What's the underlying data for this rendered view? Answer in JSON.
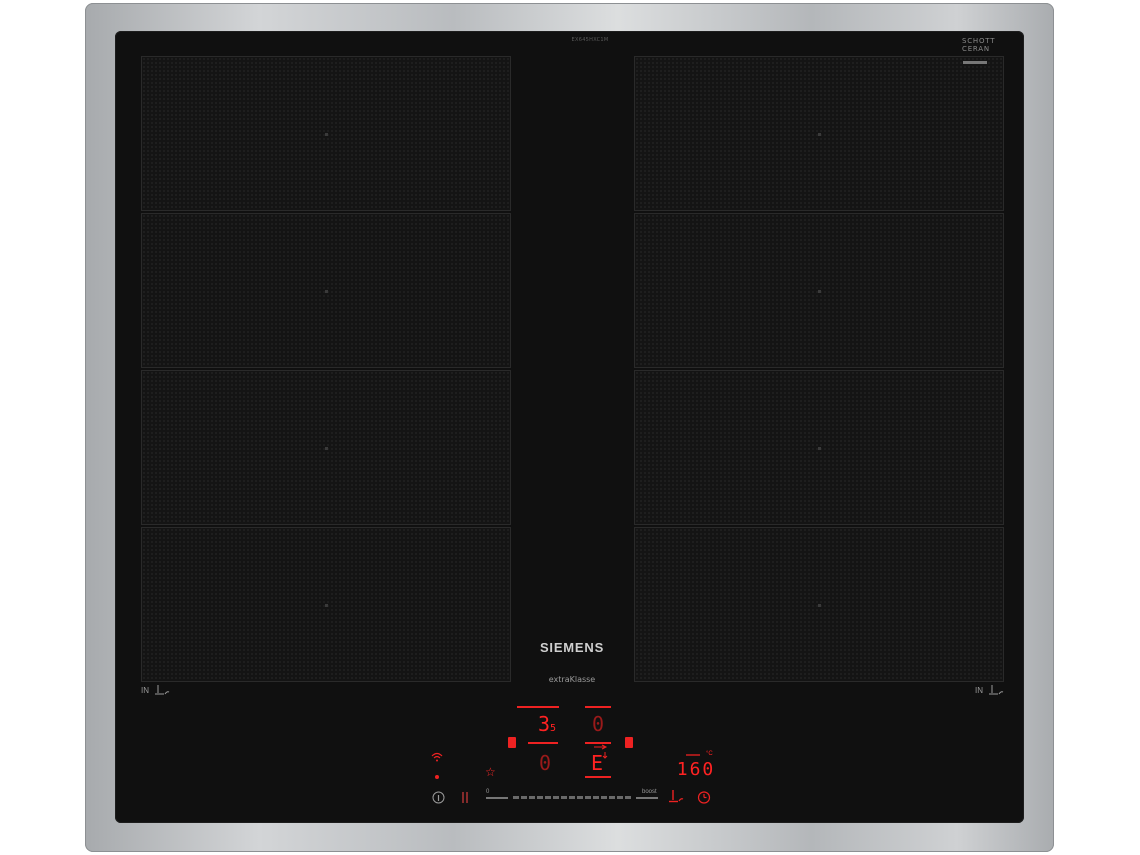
{
  "appliance": {
    "model_code": "EX645HXC1M",
    "glass_brand": [
      "SCHOTT",
      "CERAN"
    ],
    "brand": "SIEMENS",
    "sub_brand": "extraKlasse"
  },
  "zones": {
    "left_label": "IN",
    "right_label": "IN"
  },
  "display": {
    "left_power": "3",
    "left_power_sub": "5",
    "left_timer": "0",
    "left_lower": "0",
    "right_lower": "E",
    "temperature_value": "160",
    "temperature_unit": "°C"
  },
  "controls": {
    "slider_min_label": "0",
    "slider_max_label": "boost"
  },
  "colors": {
    "frame": "#bcbfc2",
    "glass": "#101010",
    "display_red": "#ff2222"
  },
  "icons": [
    "wifi-icon",
    "info-icon",
    "favorite-star-icon",
    "power-move-icon",
    "pan-sensor-icon",
    "timer-icon",
    "lock-icon"
  ]
}
